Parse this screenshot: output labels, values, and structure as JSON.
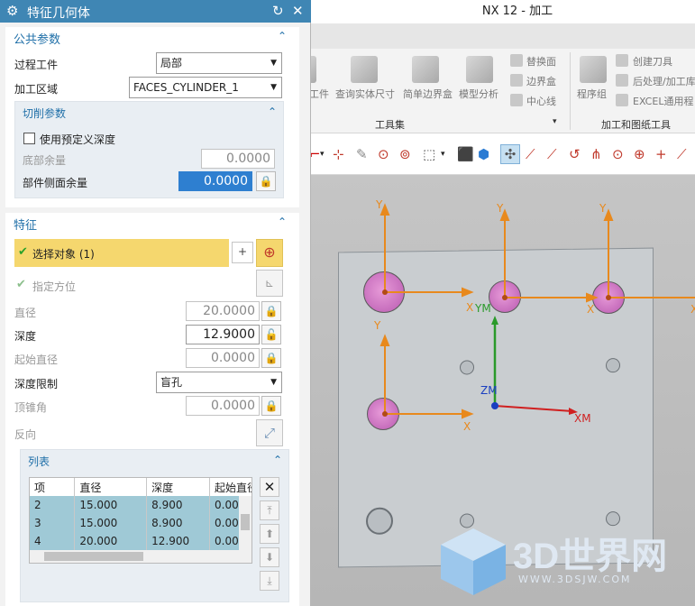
{
  "app": {
    "title": "NX 12 - 加工"
  },
  "ribbon": {
    "left_items": [
      "工件",
      "查询实体尺寸",
      "简单边界盒",
      "模型分析"
    ],
    "small_items": [
      "替换面",
      "边界盒",
      "中心线"
    ],
    "group_tools": "工具集",
    "right_items": [
      "程序组",
      "创建刀具",
      "后处理/加工库",
      "EXCEL通用程"
    ],
    "group_machining": "加工和图纸工具"
  },
  "viewport": {
    "axis_labels": {
      "y": "Y",
      "x": "X",
      "ym": "YM",
      "zm": "ZM",
      "xm": "XM"
    },
    "watermark": {
      "brand": "3D世界网",
      "url": "WWW.3DSJW.COM"
    }
  },
  "dialog": {
    "title": "特征几何体",
    "icons": {
      "gear": "gear-icon",
      "reset": "reset-icon",
      "close": "close-icon"
    },
    "common": {
      "title": "公共参数",
      "process_workpiece_label": "过程工件",
      "process_workpiece_value": "局部",
      "machining_area_label": "加工区域",
      "machining_area_value": "FACES_CYLINDER_1",
      "cut_params": {
        "title": "切削参数",
        "use_predefined_depth": "使用预定义深度",
        "bottom_stock_label": "底部余量",
        "bottom_stock_value": "0.0000",
        "side_stock_label": "部件侧面余量",
        "side_stock_value": "0.0000"
      }
    },
    "feature": {
      "title": "特征",
      "select_object": "选择对象 (1)",
      "specify_orientation": "指定方位",
      "diameter_label": "直径",
      "diameter_value": "20.0000",
      "depth_label": "深度",
      "depth_value": "12.9000",
      "start_diameter_label": "起始直径",
      "start_diameter_value": "0.0000",
      "depth_limit_label": "深度限制",
      "depth_limit_value": "盲孔",
      "tip_angle_label": "顶锥角",
      "tip_angle_value": "0.0000",
      "reverse_label": "反向"
    },
    "list": {
      "title": "列表",
      "columns": [
        "项",
        "直径",
        "深度",
        "起始直径"
      ],
      "rows": [
        [
          "2",
          "15.000",
          "8.900",
          "0.00"
        ],
        [
          "3",
          "15.000",
          "8.900",
          "0.00"
        ],
        [
          "4",
          "20.000",
          "12.900",
          "0.00"
        ]
      ]
    }
  },
  "colors": {
    "title_bar": "#3f86b4",
    "selection_yellow": "#f5d76e",
    "row_blue": "#9fc9d6",
    "accent": "#1f6fa8"
  }
}
